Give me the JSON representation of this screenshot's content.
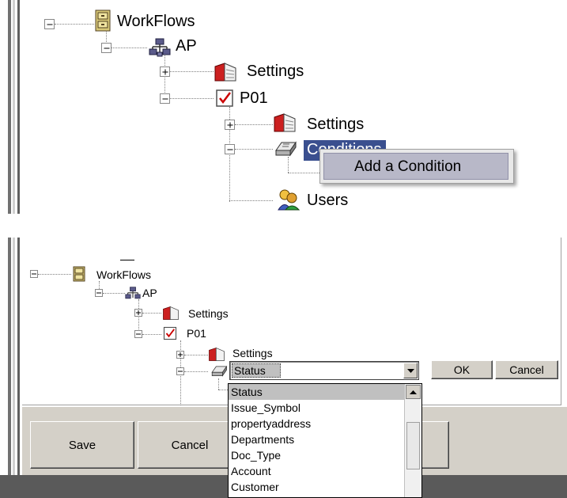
{
  "top_panel": {
    "tree": {
      "workflows_label": "WorkFlows",
      "ap_label": "AP",
      "settings_label": "Settings",
      "p01_label": "P01",
      "p01_settings_label": "Settings",
      "conditions_label": "Conditions",
      "users_label": "Users"
    },
    "context_menu": {
      "add_condition_label": "Add a Condition"
    }
  },
  "bottom_panel": {
    "tree": {
      "workflows_label": "WorkFlows",
      "ap_label": "AP",
      "settings_label": "Settings",
      "p01_label": "P01",
      "p01_settings_label": "Settings"
    },
    "condition_select": {
      "value": "Status",
      "options": [
        "Status",
        "Issue_Symbol",
        "propertyaddress",
        "Departments",
        "Doc_Type",
        "Account",
        "Customer"
      ]
    },
    "ok_label": "OK",
    "cancel_label": "Cancel",
    "footer": {
      "save_label": "Save",
      "cancel_label": "Cancel"
    }
  },
  "colors": {
    "window_gray": "#d4d0c8",
    "dark_frame": "#808080",
    "menu_highlight": "#b8b8c8"
  }
}
